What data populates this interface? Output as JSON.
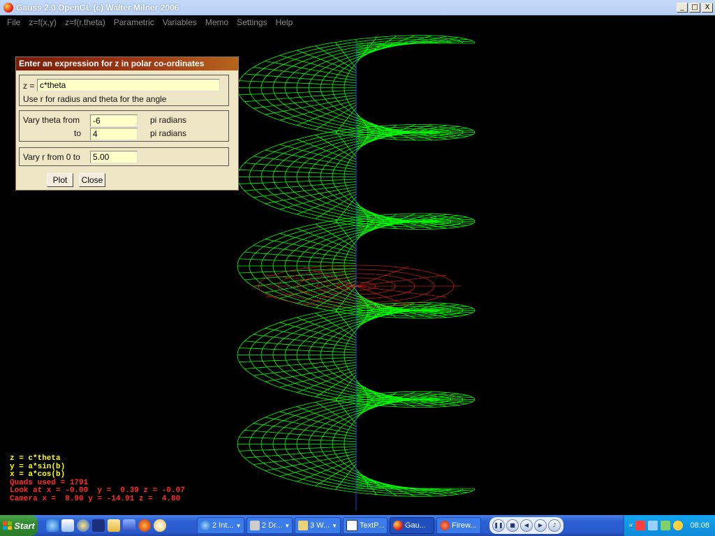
{
  "window": {
    "title": "Gauss 2.0 OpenGL (c) Walter Milner 2006",
    "controls": [
      "_",
      "□",
      "X"
    ]
  },
  "menu": [
    "File",
    "z=f(x,y)",
    "z=f(r,theta)",
    "Parametric",
    "Variables",
    "Memo",
    "Settings",
    "Help"
  ],
  "dialog": {
    "title": "Enter an expression for z in polar co-ordinates",
    "z_label": "z =",
    "z_value": "c*theta",
    "hint": "Use r for radius and theta for the angle",
    "theta_from_label": "Vary theta from",
    "theta_from_value": "-6",
    "theta_to_label": "to",
    "theta_to_value": "4",
    "unit_from": "pi radians",
    "unit_to": "pi radians",
    "r_label": "Vary r from 0 to",
    "r_value": "5.00",
    "plot_button": "Plot",
    "close_button": "Close"
  },
  "info": {
    "line1": "z = c*theta",
    "line2": "y = a*sin(b)",
    "line3": "x = a*cos(b)",
    "line4": "Quads used = 1791",
    "line5": "Look at x = -0.00  y =  0.39 z = -0.07",
    "line6": "Camera x =  8.90 y = -14.91 z =  4.80"
  },
  "colors": {
    "mesh": "#00ff00",
    "axes": "#ff2020",
    "info_yellow": "#ffff00",
    "info_red": "#ff2a2a"
  },
  "taskbar": {
    "start": "Start",
    "tasks": [
      {
        "label": "2 Int...",
        "icon": "ie-icon"
      },
      {
        "label": "2 Dr...",
        "icon": "drawing-icon"
      },
      {
        "label": "3 W...",
        "icon": "word-icon"
      },
      {
        "label": "TextP...",
        "icon": "textpad-icon"
      },
      {
        "label": "Gau...",
        "icon": "gauss-icon"
      },
      {
        "label": "Firew...",
        "icon": "fireworks-icon"
      }
    ],
    "clock": "08:08"
  }
}
